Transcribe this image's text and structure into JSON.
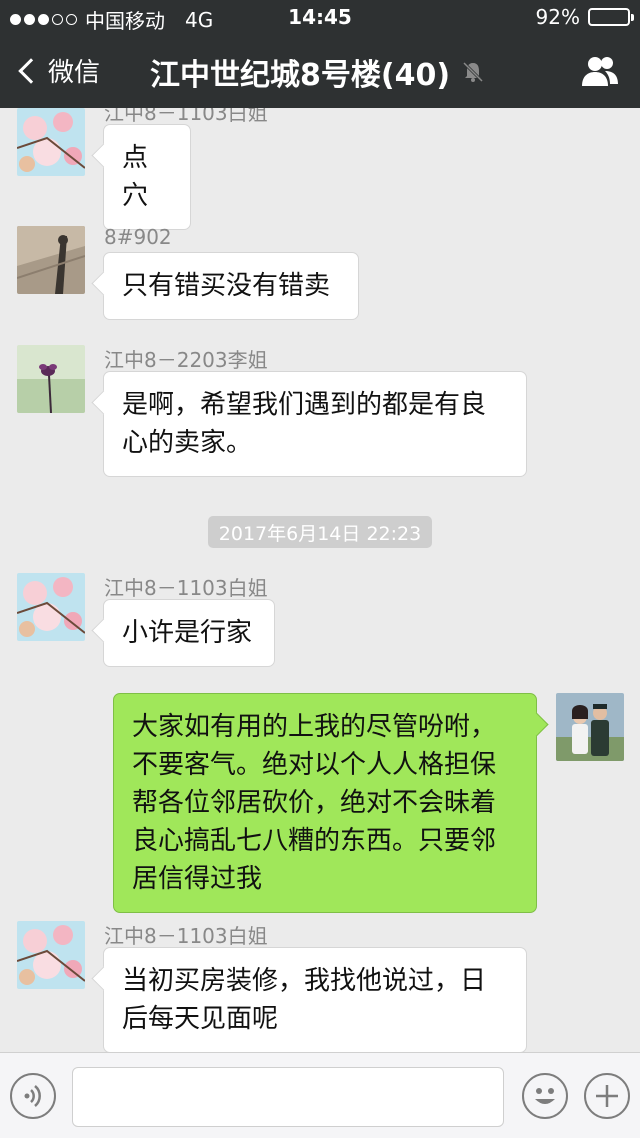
{
  "status_bar": {
    "carrier": "中国移动",
    "network": "4G",
    "time": "14:45",
    "battery_percent": "92%",
    "battery_level": 0.92,
    "signal_bars": 3
  },
  "nav": {
    "back_label": "微信",
    "title": "江中世纪城8号楼(40)",
    "muted": true
  },
  "timestamp": "2017年6月14日 22:23",
  "messages": [
    {
      "side": "left",
      "sender": "江中8－1103白姐",
      "text": "点穴",
      "avatar": "blossom-avatar"
    },
    {
      "side": "left",
      "sender": "8#902",
      "text": "只有错买没有错卖",
      "avatar": "shadow-avatar"
    },
    {
      "side": "left",
      "sender": "江中8－2203李姐",
      "text": "是啊，希望我们遇到的都是有良心的卖家。",
      "avatar": "flower-avatar"
    },
    {
      "side": "left",
      "sender": "江中8－1103白姐",
      "text": "小许是行家",
      "avatar": "blossom-avatar"
    },
    {
      "side": "right",
      "sender": "",
      "text": "大家如有用的上我的尽管吩咐，不要客气。绝对以个人人格担保帮各位邻居砍价，绝对不会昧着良心搞乱七八糟的东西。只要邻居信得过我",
      "avatar": "couple-avatar"
    },
    {
      "side": "left",
      "sender": "江中8－1103白姐",
      "text": "当初买房装修，我找他说过，日后每天见面呢",
      "avatar": "blossom-avatar"
    }
  ],
  "colors": {
    "nav_bg": "#2e3132",
    "chat_bg": "#ebebeb",
    "self_bubble": "#a0e75a",
    "battery_fill": "#4cd964"
  },
  "icons": {
    "back": "chevron-left-icon",
    "mute": "mute-bell-icon",
    "members": "group-members-icon",
    "voice": "voice-icon",
    "emoji": "emoji-icon",
    "more": "plus-icon"
  }
}
